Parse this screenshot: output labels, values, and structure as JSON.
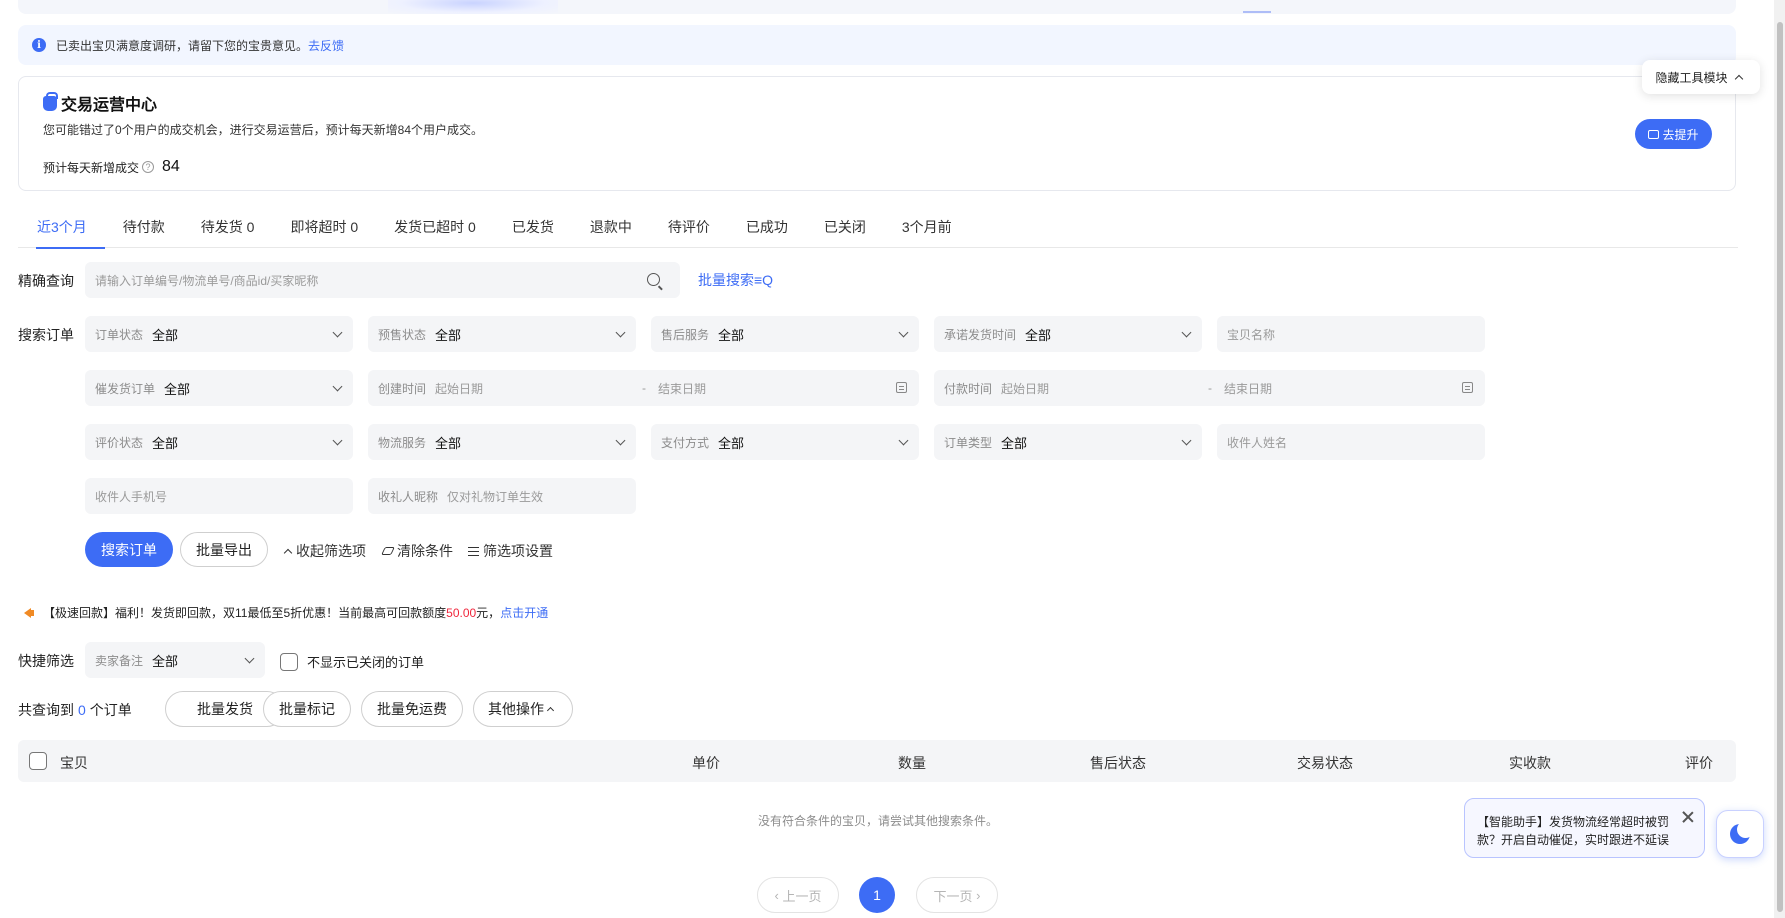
{
  "survey": {
    "text": "已卖出宝贝满意度调研，请留下您的宝贵意见。",
    "link": "去反馈"
  },
  "trade_center": {
    "title": "交易运营中心",
    "desc": "您可能错过了0个用户的成交机会，进行交易运营后，预计每天新增84个用户成交。",
    "metric_label": "预计每天新增成交",
    "metric_value": "84",
    "upgrade_label": "去提升"
  },
  "hide_tools_label": "隐藏工具模块",
  "tabs": [
    {
      "label": "近3个月",
      "active": true
    },
    {
      "label": "待付款"
    },
    {
      "label": "待发货 0"
    },
    {
      "label": "即将超时 0"
    },
    {
      "label": "发货已超时 0"
    },
    {
      "label": "已发货"
    },
    {
      "label": "退款中"
    },
    {
      "label": "待评价"
    },
    {
      "label": "已成功"
    },
    {
      "label": "已关闭"
    },
    {
      "label": "3个月前"
    }
  ],
  "precise": {
    "label": "精确查询",
    "placeholder": "请输入订单编号/物流单号/商品id/买家昵称",
    "batch_search": "批量搜索"
  },
  "search_label": "搜索订单",
  "filters": {
    "order_status": {
      "label": "订单状态",
      "value": "全部"
    },
    "presale_status": {
      "label": "预售状态",
      "value": "全部"
    },
    "after_sale": {
      "label": "售后服务",
      "value": "全部"
    },
    "promise_ship_time": {
      "label": "承诺发货时间",
      "value": "全部"
    },
    "item_name": {
      "placeholder": "宝贝名称"
    },
    "urge_ship": {
      "label": "催发货订单",
      "value": "全部"
    },
    "create_time": {
      "label": "创建时间",
      "start": "起始日期",
      "sep": "-",
      "end": "结束日期"
    },
    "pay_time": {
      "label": "付款时间",
      "start": "起始日期",
      "sep": "-",
      "end": "结束日期"
    },
    "review_status": {
      "label": "评价状态",
      "value": "全部"
    },
    "logistics": {
      "label": "物流服务",
      "value": "全部"
    },
    "pay_method": {
      "label": "支付方式",
      "value": "全部"
    },
    "order_type": {
      "label": "订单类型",
      "value": "全部"
    },
    "receiver_name": {
      "placeholder": "收件人姓名"
    },
    "receiver_phone": {
      "placeholder": "收件人手机号"
    },
    "gift_nick": {
      "label": "收礼人昵称",
      "placeholder": "仅对礼物订单生效"
    }
  },
  "actions": {
    "search": "搜索订单",
    "export": "批量导出",
    "collapse": "收起筛选项",
    "clear": "清除条件",
    "settings": "筛选项设置"
  },
  "promo": {
    "text_before": "【极速回款】福利！发货即回款，双11最低至5折优惠！当前最高可回款额度",
    "amount": "50.00",
    "text_after": "元，",
    "link": "点击开通"
  },
  "quick_filter": {
    "label": "快捷筛选",
    "seller_note_label": "卖家备注",
    "seller_note_value": "全部",
    "hide_closed": "不显示已关闭的订单"
  },
  "result": {
    "prefix": "共查询到",
    "count": "0",
    "suffix": "个订单"
  },
  "bulk": {
    "ship": "批量发货",
    "mark": "批量标记",
    "free_ship": "批量免运费",
    "other": "其他操作"
  },
  "table": {
    "columns": [
      "宝贝",
      "单价",
      "数量",
      "售后状态",
      "交易状态",
      "实收款",
      "评价"
    ],
    "empty_text": "没有符合条件的宝贝，请尝试其他搜索条件。"
  },
  "pagination": {
    "prev": "上一页",
    "current": "1",
    "next": "下一页"
  },
  "assistant_tip": "【智能助手】发货物流经常超时被罚款？开启自动催促，实时跟进不延误",
  "colors": {
    "primary": "#3d6cf5",
    "danger": "#f0263c",
    "warning": "#f08a24"
  }
}
